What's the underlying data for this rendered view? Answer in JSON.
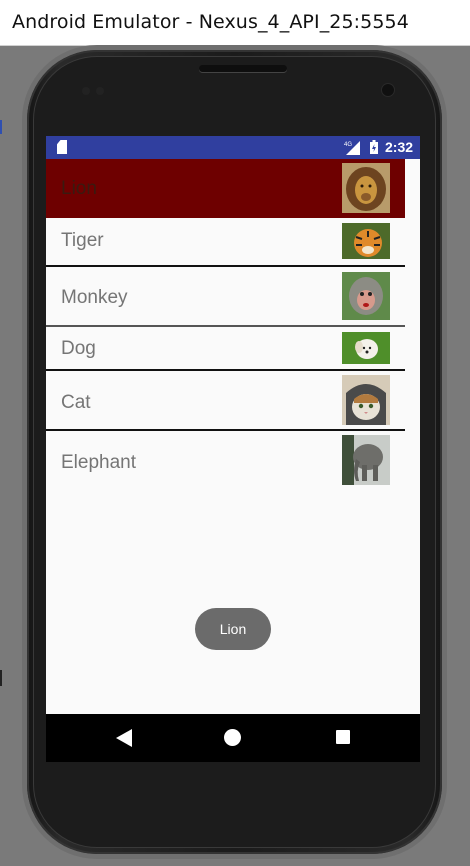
{
  "window": {
    "title": "Android Emulator - Nexus_4_API_25:5554"
  },
  "status_bar": {
    "network": "4G",
    "time": "2:32",
    "color": "#303f9f"
  },
  "list": {
    "items": [
      {
        "label": "Lion",
        "image_icon": "lion-photo-icon",
        "selected": true
      },
      {
        "label": "Tiger",
        "image_icon": "tiger-photo-icon",
        "selected": false
      },
      {
        "label": "Monkey",
        "image_icon": "monkey-photo-icon",
        "selected": false
      },
      {
        "label": "Dog",
        "image_icon": "dog-photo-icon",
        "selected": false
      },
      {
        "label": "Cat",
        "image_icon": "cat-photo-icon",
        "selected": false
      },
      {
        "label": "Elephant",
        "image_icon": "elephant-photo-icon",
        "selected": false
      }
    ],
    "selected_color": "#6e0000"
  },
  "toast": {
    "text": "Lion"
  },
  "nav_bar": {
    "back_icon": "back-triangle-icon",
    "home_icon": "home-circle-icon",
    "recents_icon": "recents-square-icon"
  }
}
